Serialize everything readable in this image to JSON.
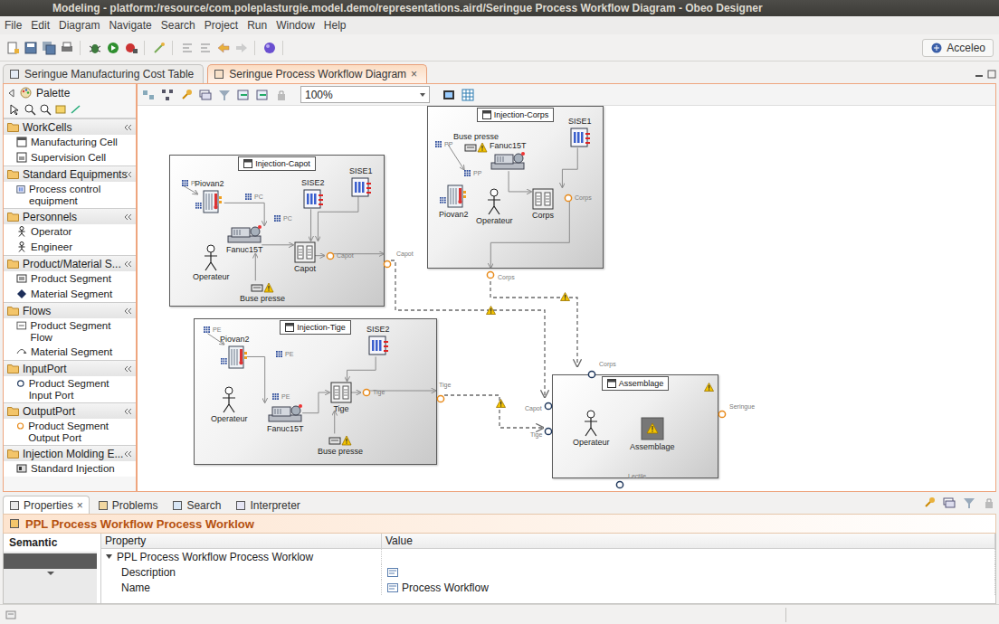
{
  "window": {
    "title": "Modeling - platform:/resource/com.poleplasturgie.model.demo/representations.aird/Seringue Process Workflow Diagram - Obeo Designer"
  },
  "menu": [
    "File",
    "Edit",
    "Diagram",
    "Navigate",
    "Search",
    "Project",
    "Run",
    "Window",
    "Help"
  ],
  "toolbar": {
    "perspective": "Acceleo"
  },
  "editor_tabs": [
    {
      "label": "Seringue Manufacturing Cost Table",
      "selected": false
    },
    {
      "label": "Seringue Process Workflow Diagram",
      "selected": true,
      "close": "×"
    }
  ],
  "palette": {
    "title": "Palette",
    "sections": [
      {
        "title": "WorkCells",
        "items": [
          {
            "label": "Manufacturing Cell",
            "kind": "cell"
          },
          {
            "label": "Supervision Cell",
            "kind": "supervision"
          }
        ]
      },
      {
        "title": "Standard Equipments",
        "items": [
          {
            "label": "Process control equipment",
            "kind": "equipment"
          }
        ]
      },
      {
        "title": "Personnels",
        "items": [
          {
            "label": "Operator",
            "kind": "operator"
          },
          {
            "label": "Engineer",
            "kind": "engineer"
          }
        ]
      },
      {
        "title": "Product/Material S...",
        "items": [
          {
            "label": "Product Segment",
            "kind": "product"
          },
          {
            "label": "Material Segment",
            "kind": "material"
          }
        ]
      },
      {
        "title": "Flows",
        "items": [
          {
            "label": "Product Segment Flow",
            "kind": "flow"
          },
          {
            "label": "Material Segment",
            "kind": "material-flow"
          }
        ]
      },
      {
        "title": "InputPort",
        "items": [
          {
            "label": "Product Segment Input Port",
            "kind": "input"
          }
        ]
      },
      {
        "title": "OutputPort",
        "items": [
          {
            "label": "Product Segment Output Port",
            "kind": "output"
          }
        ]
      },
      {
        "title": "Injection Molding E...",
        "items": [
          {
            "label": "Standard Injection",
            "kind": "injection"
          }
        ]
      }
    ]
  },
  "diagram_toolbar": {
    "zoom": "100%"
  },
  "diagram": {
    "containers": [
      {
        "title": "Injection-Capot",
        "warning": false,
        "nodes": [
          {
            "label": "Piovan2",
            "kind": "piovan"
          },
          {
            "label": "SISE2",
            "kind": "sise"
          },
          {
            "label": "SISE1",
            "kind": "sise"
          },
          {
            "label": "Fanuc15T",
            "kind": "fanuc"
          },
          {
            "label": "Operateur",
            "kind": "operator"
          },
          {
            "label": "Capot",
            "kind": "buffer"
          },
          {
            "label": "Buse presse",
            "kind": "buse"
          }
        ],
        "notes": [
          {
            "label": "PC",
            "kind": "flow"
          },
          {
            "label": "PC",
            "kind": "flow"
          },
          {
            "label": "PC",
            "kind": "flow"
          },
          {
            "label": "Capot",
            "kind": "port"
          }
        ]
      },
      {
        "title": "Injection-Corps",
        "warning": false,
        "nodes": [
          {
            "label": "Buse presse",
            "kind": "buse"
          },
          {
            "label": "Fanuc15T",
            "kind": "fanuc"
          },
          {
            "label": "SISE1",
            "kind": "sise"
          },
          {
            "label": "Piovan2",
            "kind": "piovan"
          },
          {
            "label": "Operateur",
            "kind": "operator"
          },
          {
            "label": "Corps",
            "kind": "buffer"
          }
        ],
        "notes": [
          {
            "label": "PP",
            "kind": "flow"
          },
          {
            "label": "PP",
            "kind": "flow"
          },
          {
            "label": "Corps",
            "kind": "port"
          }
        ]
      },
      {
        "title": "Injection-Tige",
        "warning": false,
        "nodes": [
          {
            "label": "Piovan2",
            "kind": "piovan"
          },
          {
            "label": "SISE2",
            "kind": "sise"
          },
          {
            "label": "Operateur",
            "kind": "operator"
          },
          {
            "label": "Fanuc15T",
            "kind": "fanuc"
          },
          {
            "label": "Tige",
            "kind": "buffer"
          },
          {
            "label": "Buse presse",
            "kind": "buse"
          }
        ],
        "notes": [
          {
            "label": "PE",
            "kind": "flow"
          },
          {
            "label": "PE",
            "kind": "flow"
          },
          {
            "label": "PE",
            "kind": "flow"
          },
          {
            "label": "Tige",
            "kind": "port"
          }
        ]
      },
      {
        "title": "Assemblage",
        "warning": true,
        "nodes": [
          {
            "label": "Operateur",
            "kind": "operator"
          },
          {
            "label": "Assemblage",
            "kind": "assemblage"
          }
        ],
        "notes": []
      }
    ],
    "ports": [
      {
        "label": "Capot",
        "kind": "output"
      },
      {
        "label": "Corps",
        "kind": "output"
      },
      {
        "label": "Tige",
        "kind": "output"
      },
      {
        "label": "Corps",
        "kind": "input"
      },
      {
        "label": "Capot",
        "kind": "input"
      },
      {
        "label": "Tige",
        "kind": "input"
      },
      {
        "label": "Seringue",
        "kind": "output"
      },
      {
        "label": "Lectile",
        "kind": "input"
      }
    ],
    "edges": [
      {
        "warning": true
      },
      {
        "warning": true
      },
      {
        "warning": true
      }
    ]
  },
  "properties": {
    "tabs": [
      {
        "label": "Properties",
        "selected": true,
        "close": "×"
      },
      {
        "label": "Problems",
        "selected": false
      },
      {
        "label": "Search",
        "selected": false
      },
      {
        "label": "Interpreter",
        "selected": false
      }
    ],
    "title": "PPL Process Workflow Process Worklow",
    "side_tabs": [
      {
        "label": "Semantic",
        "selected": true
      }
    ],
    "columns": [
      "Property",
      "Value"
    ],
    "rows": [
      {
        "property": "PPL Process Workflow Process Worklow",
        "kind": "group",
        "expanded": true
      },
      {
        "property": "Description",
        "kind": "field"
      },
      {
        "property": "Name",
        "kind": "field",
        "value": "Process Workflow"
      }
    ]
  }
}
